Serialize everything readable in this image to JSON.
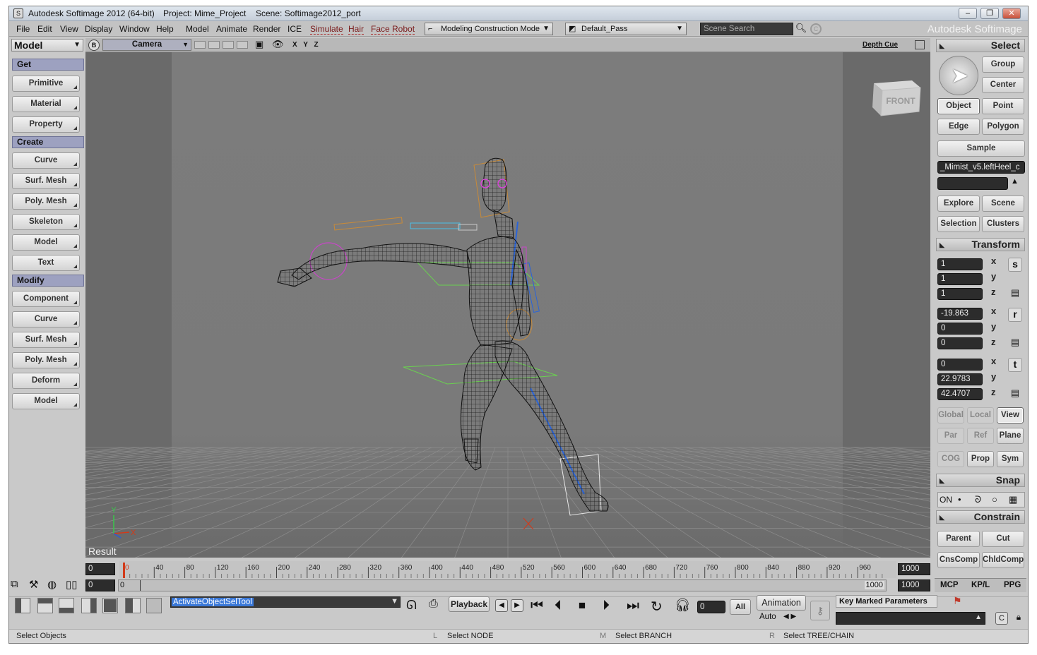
{
  "titlebar": {
    "app": "Autodesk Softimage 2012 (64-bit)",
    "project": "Project: Mime_Project",
    "scene": "Scene: Softimage2012_port"
  },
  "menu": [
    "File",
    "Edit",
    "View",
    "Display",
    "Window",
    "Help",
    "Model",
    "Animate",
    "Render",
    "ICE",
    "Simulate",
    "Hair",
    "Face Robot"
  ],
  "toolbar": {
    "mode": "Modeling Construction Mode",
    "pass": "Default_Pass",
    "search_placeholder": "Scene Search",
    "brand": "Autodesk Softimage"
  },
  "left_panel": {
    "module": "Model",
    "get_head": "Get",
    "get_items": [
      "Primitive",
      "Material",
      "Property"
    ],
    "create_head": "Create",
    "create_items": [
      "Curve",
      "Surf. Mesh",
      "Poly. Mesh",
      "Skeleton",
      "Model",
      "Text"
    ],
    "modify_head": "Modify",
    "modify_items": [
      "Component",
      "Curve",
      "Surf. Mesh",
      "Poly. Mesh",
      "Deform",
      "Model"
    ]
  },
  "viewport": {
    "camera": "Camera",
    "axes": "X Y Z",
    "depth_cue": "Depth Cue",
    "result": "Result",
    "cube_label": "FRONT",
    "gizmo_y": "Y",
    "gizmo_x": "X"
  },
  "right_panel": {
    "select_head": "Select",
    "group": "Group",
    "center": "Center",
    "object": "Object",
    "point": "Point",
    "edge": "Edge",
    "polygon": "Polygon",
    "sample": "Sample",
    "selection_name": "_Mimist_v5.leftHeel_c",
    "explore": "Explore",
    "scene": "Scene",
    "selection": "Selection",
    "clusters": "Clusters",
    "transform_head": "Transform",
    "scale": [
      "1",
      "1",
      "1"
    ],
    "rotate": [
      "-19.863",
      "0",
      "0"
    ],
    "translate": [
      "0",
      "22.9783",
      "42.4707"
    ],
    "axis_labels": [
      "x",
      "y",
      "z"
    ],
    "s_label": "s",
    "r_label": "r",
    "t_label": "t",
    "global": "Global",
    "local": "Local",
    "view": "View",
    "par": "Par",
    "ref": "Ref",
    "plane": "Plane",
    "cog": "COG",
    "prop": "Prop",
    "sym": "Sym",
    "snap_head": "Snap",
    "snap_on": "ON",
    "constrain_head": "Constrain",
    "parent": "Parent",
    "cut": "Cut",
    "cnscomp": "CnsComp",
    "chldcomp": "ChldComp",
    "tabs": [
      "MCP",
      "KP/L",
      "PPG"
    ]
  },
  "timeline": {
    "start": "0",
    "end": "1000",
    "ticks": [
      "0",
      "40",
      "80",
      "120",
      "160",
      "200",
      "240",
      "280",
      "320",
      "360",
      "400",
      "440",
      "480",
      "520",
      "560",
      "600",
      "640",
      "680",
      "720",
      "760",
      "800",
      "840",
      "880",
      "920",
      "960"
    ],
    "range_start": "0",
    "range_inner": "0",
    "range_end_inner": "1000",
    "range_end": "1000"
  },
  "bottom": {
    "command": "ActivateObjectSelTool",
    "playback": "Playback",
    "frame": "0",
    "all": "All",
    "animation": "Animation",
    "auto": "Auto",
    "key_marked": "Key Marked Parameters"
  },
  "statusbar": {
    "left": "Select Objects",
    "l_key": "L",
    "l_text": "Select NODE",
    "m_key": "M",
    "m_text": "Select BRANCH",
    "r_key": "R",
    "r_text": "Select TREE/CHAIN"
  },
  "colors": {
    "viewport_bg": "#6c6c6c",
    "floor": "#7a7a7a",
    "grid": "#8d8d8d",
    "panel": "#c9c9c9",
    "section_head": "#9da1c0",
    "field": "#2c2c2c",
    "timeline_marker": "#d23a1a"
  }
}
